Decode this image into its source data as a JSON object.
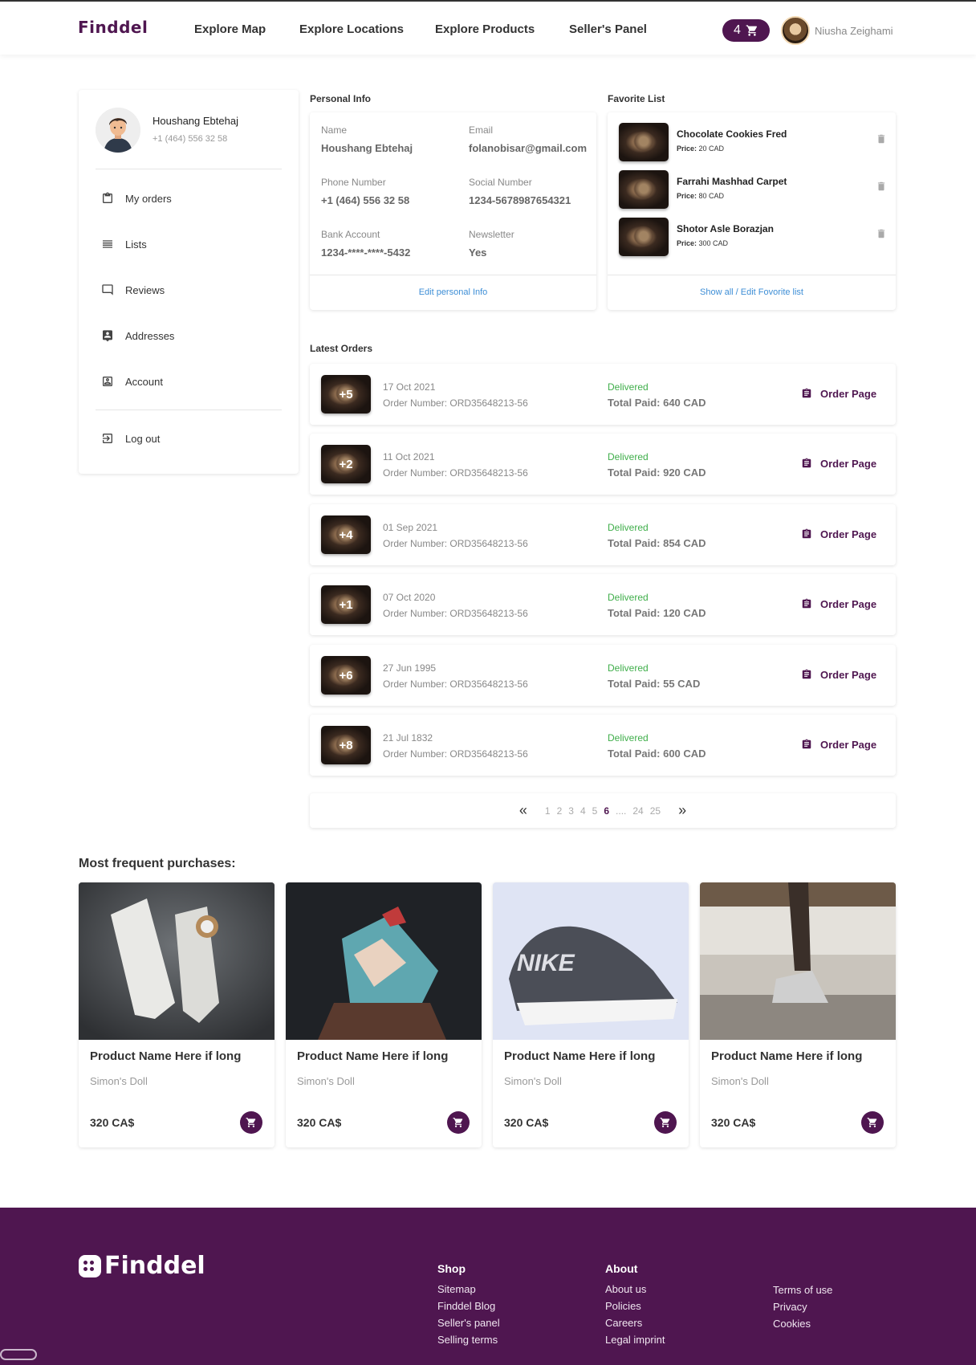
{
  "header": {
    "logo": "Finddel",
    "nav": [
      "Explore Map",
      "Explore Locations",
      "Explore Products",
      "Seller's Panel"
    ],
    "cart_count": "4",
    "user_name": "Niusha Zeighami"
  },
  "sidebar": {
    "name": "Houshang Ebtehaj",
    "phone": "+1 (464) 556 32 58",
    "items": [
      {
        "label": "My orders",
        "icon": "clipboard-icon"
      },
      {
        "label": "Lists",
        "icon": "list-icon"
      },
      {
        "label": "Reviews",
        "icon": "comment-icon"
      },
      {
        "label": "Addresses",
        "icon": "contact-card-icon"
      },
      {
        "label": "Account",
        "icon": "account-box-icon"
      }
    ],
    "logout": "Log out"
  },
  "personal_info": {
    "title": "Personal Info",
    "fields": [
      {
        "label": "Name",
        "value": "Houshang Ebtehaj"
      },
      {
        "label": "Email",
        "value": "folanobisar@gmail.com"
      },
      {
        "label": "Phone Number",
        "value": "+1 (464) 556 32 58"
      },
      {
        "label": "Social Number",
        "value": "1234-5678987654321"
      },
      {
        "label": "Bank Account",
        "value": "1234-****-****-5432"
      },
      {
        "label": "Newsletter",
        "value": "Yes"
      }
    ],
    "edit_link": "Edit personal Info"
  },
  "favorites": {
    "title": "Favorite List",
    "price_label": "Price:",
    "items": [
      {
        "name": "Chocolate Cookies Fred",
        "price": "20 CAD"
      },
      {
        "name": "Farrahi Mashhad Carpet",
        "price": "80 CAD"
      },
      {
        "name": "Shotor Asle Borazjan",
        "price": "300 CAD"
      }
    ],
    "edit_link": "Show all / Edit Fovorite list"
  },
  "orders": {
    "title": "Latest Orders",
    "items": [
      {
        "count": "+5",
        "date": "17 Oct 2021",
        "number": "Order Number: ORD35648213-56",
        "status": "Delivered",
        "total": "Total Paid: 640 CAD",
        "button": "Order Page"
      },
      {
        "count": "+2",
        "date": "11 Oct 2021",
        "number": "Order Number: ORD35648213-56",
        "status": "Delivered",
        "total": "Total Paid: 920 CAD",
        "button": "Order Page"
      },
      {
        "count": "+4",
        "date": "01 Sep 2021",
        "number": "Order Number: ORD35648213-56",
        "status": "Delivered",
        "total": "Total Paid: 854 CAD",
        "button": "Order Page"
      },
      {
        "count": "+1",
        "date": "07 Oct 2020",
        "number": "Order Number: ORD35648213-56",
        "status": "Delivered",
        "total": "Total Paid: 120 CAD",
        "button": "Order Page"
      },
      {
        "count": "+6",
        "date": "27 Jun 1995",
        "number": "Order Number: ORD35648213-56",
        "status": "Delivered",
        "total": "Total Paid: 55 CAD",
        "button": "Order Page"
      },
      {
        "count": "+8",
        "date": "21 Jul 1832",
        "number": "Order Number: ORD35648213-56",
        "status": "Delivered",
        "total": "Total Paid: 600 CAD",
        "button": "Order Page"
      }
    ]
  },
  "pagination": {
    "pages": [
      "1",
      "2",
      "3",
      "4",
      "5",
      "6",
      "....",
      "24",
      "25"
    ],
    "current": "6"
  },
  "frequent": {
    "title": "Most frequent purchases:",
    "products": [
      {
        "name": "Product Name Here if long",
        "seller": "Simon's Doll",
        "price": "320 CA$"
      },
      {
        "name": "Product Name Here if long",
        "seller": "Simon's Doll",
        "price": "320 CA$"
      },
      {
        "name": "Product Name Here if long",
        "seller": "Simon's Doll",
        "price": "320 CA$"
      },
      {
        "name": "Product Name Here if long",
        "seller": "Simon's Doll",
        "price": "320 CA$"
      }
    ]
  },
  "footer": {
    "logo": "Finddel",
    "shop": {
      "title": "Shop",
      "links": [
        "Sitemap",
        "Finddel Blog",
        "Seller's panel",
        "Selling terms"
      ]
    },
    "about": {
      "title": "About",
      "links": [
        "About us",
        "Policies",
        "Careers",
        "Legal imprint"
      ]
    },
    "extra": {
      "links": [
        "Terms of use",
        "Privacy",
        "Cookies"
      ]
    }
  },
  "colors": {
    "brand": "#4f1650",
    "delivered": "#3fae4a",
    "link": "#3d8ed6"
  }
}
